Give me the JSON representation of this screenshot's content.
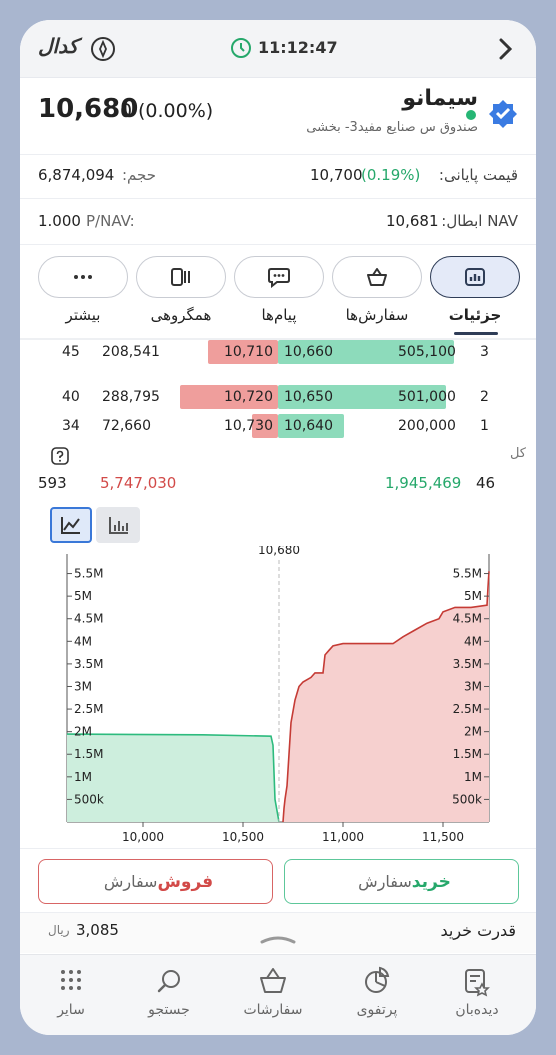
{
  "status_bar": {
    "carrier_logo": "کدال",
    "time": "11:12:47"
  },
  "stock": {
    "symbol": "سیمانو",
    "full_name": "صندوق س صنایع مفید3- بخشی",
    "last_price": "10,680",
    "change": "0",
    "change_percent": "(0.00%)",
    "volume_label": "حجم:",
    "volume": "6,874,094",
    "close_price_label": "قیمت پایانی:",
    "close_price": "10,700",
    "close_change_percent": "(0.19%)",
    "pnav_label": "P/NAV:",
    "pnav": "1.000",
    "nav_label": "NAV ابطال:",
    "nav": "10,681"
  },
  "tabs": [
    {
      "label": "جزئیات",
      "icon": "chart-icon",
      "active": true
    },
    {
      "label": "سفارش‌ها",
      "icon": "basket-icon",
      "active": false
    },
    {
      "label": "پیام‌ها",
      "icon": "message-icon",
      "active": false
    },
    {
      "label": "همگروهی",
      "icon": "group-icon",
      "active": false
    },
    {
      "label": "بیشتر",
      "icon": "more-icon",
      "active": false
    }
  ],
  "order_book": {
    "rows": [
      {
        "level": "3",
        "buy_volume": "505,100",
        "buy_price": "10,660",
        "sell_price": "10,710",
        "sell_volume": "208,541",
        "sell_count": "45",
        "buy_bar": 0.97,
        "sell_bar": 0.36
      },
      {
        "level": "2",
        "buy_volume": "501,000",
        "buy_price": "10,650",
        "sell_price": "10,720",
        "sell_volume": "288,795",
        "sell_count": "40",
        "buy_bar": 0.96,
        "sell_bar": 0.5
      },
      {
        "level": "1",
        "buy_volume": "200,000",
        "buy_price": "10,640",
        "sell_price": "10,730",
        "sell_volume": "72,660",
        "sell_count": "34",
        "buy_bar": 0.38,
        "sell_bar": 0.13
      }
    ],
    "total_label": "کل",
    "total_buy_count": "46",
    "total_buy_volume": "1,945,469",
    "total_sell_volume": "5,747,030",
    "total_sell_count": "593"
  },
  "chart_data": {
    "type": "area",
    "title": "10,680",
    "x_ticks": [
      "10,000",
      "10,500",
      "11,000",
      "11,500"
    ],
    "y_ticks": [
      "500k",
      "1M",
      "1.5M",
      "2M",
      "2.5M",
      "3M",
      "3.5M",
      "4M",
      "4.5M",
      "5M",
      "5.5M"
    ],
    "xlim": [
      9620,
      11730
    ],
    "ylim": [
      0,
      5800000
    ],
    "reference_price": 10680,
    "series": [
      {
        "side": "buy",
        "color": "#2dbb7e",
        "points": [
          [
            9620,
            1945469
          ],
          [
            10300,
            1930000
          ],
          [
            10640,
            1900000
          ],
          [
            10650,
            1700000
          ],
          [
            10660,
            500000
          ],
          [
            10680,
            0
          ]
        ]
      },
      {
        "side": "sell",
        "color": "#c53b35",
        "points": [
          [
            10700,
            0
          ],
          [
            10705,
            300000
          ],
          [
            10710,
            500000
          ],
          [
            10720,
            800000
          ],
          [
            10730,
            1500000
          ],
          [
            10740,
            2200000
          ],
          [
            10760,
            2700000
          ],
          [
            10780,
            3000000
          ],
          [
            10800,
            3100000
          ],
          [
            10840,
            3200000
          ],
          [
            10860,
            3300000
          ],
          [
            10900,
            3300000
          ],
          [
            10910,
            3700000
          ],
          [
            10930,
            3800000
          ],
          [
            10950,
            3900000
          ],
          [
            11000,
            3950000
          ],
          [
            11250,
            3950000
          ],
          [
            11300,
            4100000
          ],
          [
            11360,
            4250000
          ],
          [
            11420,
            4400000
          ],
          [
            11480,
            4500000
          ],
          [
            11500,
            4650000
          ],
          [
            11560,
            4750000
          ],
          [
            11640,
            4750000
          ],
          [
            11720,
            4800000
          ],
          [
            11725,
            5200000
          ],
          [
            11730,
            5550000
          ]
        ]
      }
    ]
  },
  "chart_toggle": {
    "line_icon": "line-chart-icon",
    "bar_icon": "bar-chart-icon"
  },
  "actions": {
    "buy_prefix": "سفارش",
    "buy_label": "خرید",
    "sell_prefix": "سفارش",
    "sell_label": "فروش"
  },
  "buying_power": {
    "label": "قدرت خرید",
    "value": "3,085",
    "currency": "ریال"
  },
  "bottom_nav": [
    {
      "label": "دیده‌بان",
      "icon": "watchlist-icon"
    },
    {
      "label": "پرتفوی",
      "icon": "portfolio-icon"
    },
    {
      "label": "سفارشات",
      "icon": "orders-icon"
    },
    {
      "label": "جستجو",
      "icon": "search-icon"
    },
    {
      "label": "سایر",
      "icon": "grid-icon"
    }
  ],
  "colors": {
    "buy": "#26a86b",
    "sell": "#d24a48",
    "accent": "#2f6fe0"
  }
}
